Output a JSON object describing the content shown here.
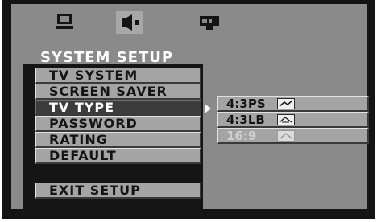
{
  "menu": {
    "title": "SYSTEM SETUP",
    "items": [
      {
        "label": "TV SYSTEM"
      },
      {
        "label": "SCREEN SAVER"
      },
      {
        "label": "TV TYPE"
      },
      {
        "label": "PASSWORD"
      },
      {
        "label": "RATING"
      },
      {
        "label": "DEFAULT"
      }
    ],
    "exit_label": "EXIT SETUP"
  },
  "submenu": {
    "options": [
      {
        "label": "4:3PS"
      },
      {
        "label": "4:3LB"
      },
      {
        "label": "16:9"
      }
    ]
  },
  "icons": [
    "monitor-icon",
    "speaker-icon",
    "settings-icon"
  ],
  "colors": {
    "background": "#8a8a8a",
    "frame": "#141414",
    "item": "#a4a4a4",
    "selected": "#3c3c3c"
  }
}
